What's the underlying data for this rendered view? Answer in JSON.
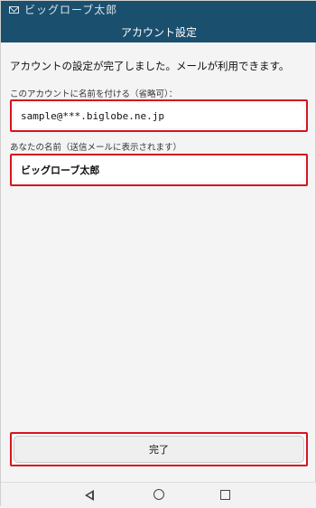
{
  "status_bar": {
    "notification_text": "ビッグローブ太郎"
  },
  "header": {
    "title": "アカウント設定"
  },
  "message": "アカウントの設定が完了しました。メールが利用できます。",
  "account_name": {
    "label": "このアカウントに名前を付ける（省略可）：",
    "value": "sample@***.biglobe.ne.jp"
  },
  "your_name": {
    "label": "あなたの名前（送信メールに表示されます）",
    "value": "ビッグローブ太郎"
  },
  "done_button": {
    "label": "完了"
  },
  "highlight_color": "#d4141f",
  "header_color": "#1b4f6e",
  "nav": {
    "back_icon": "back-triangle",
    "home_icon": "home-circle",
    "recents_icon": "recents-square"
  }
}
